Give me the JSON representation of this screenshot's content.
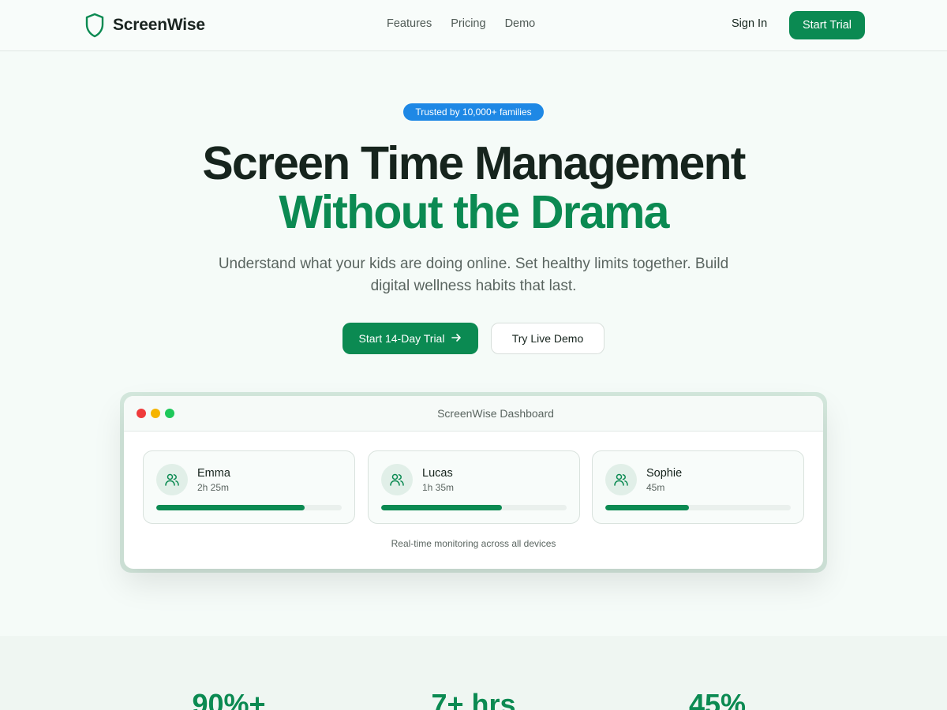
{
  "nav": {
    "brand": "ScreenWise",
    "links": [
      "Features",
      "Pricing",
      "Demo"
    ],
    "sign_in": "Sign In",
    "cta": "Start Trial"
  },
  "hero": {
    "badge": "Trusted by 10,000+ families",
    "headline_line1": "Screen Time Management",
    "headline_line2": "Without the Drama",
    "subtitle": "Understand what your kids are doing online. Set healthy limits together. Build digital wellness habits that last.",
    "primary_button": "Start 14-Day Trial",
    "secondary_button": "Try Live Demo"
  },
  "dashboard": {
    "title": "ScreenWise Dashboard",
    "kids": [
      {
        "name": "Emma",
        "time": "2h 25m",
        "progress": 0.8
      },
      {
        "name": "Lucas",
        "time": "1h 35m",
        "progress": 0.65
      },
      {
        "name": "Sophie",
        "time": "45m",
        "progress": 0.45
      }
    ],
    "caption": "Real-time monitoring across all devices"
  },
  "stats": [
    "90%+",
    "7+ hrs",
    "45%"
  ],
  "colors": {
    "brand_green": "#0b8a52",
    "badge_blue": "#1e88e5",
    "background": "#f5fbf8"
  }
}
